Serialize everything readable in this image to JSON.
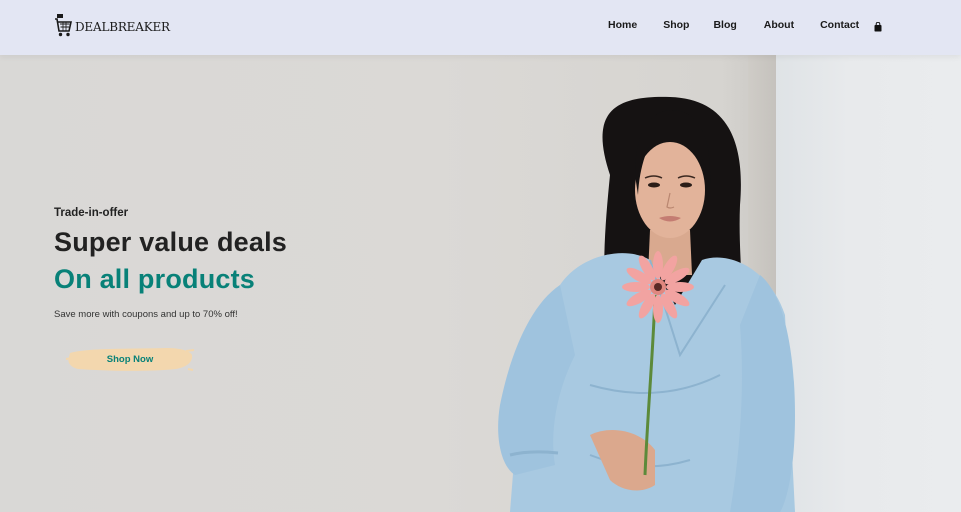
{
  "brand": {
    "name": "DEALBREAKER",
    "icon": "cart-logo-icon"
  },
  "nav": {
    "items": [
      {
        "label": "Home"
      },
      {
        "label": "Shop"
      },
      {
        "label": "Blog"
      },
      {
        "label": "About"
      },
      {
        "label": "Contact"
      }
    ],
    "cart_icon": "shopping-bag-icon"
  },
  "hero": {
    "eyebrow": "Trade-in-offer",
    "headline": "Super value deals",
    "headline_accent": "On all products",
    "subtext": "Save more with coupons and up to 70% off!",
    "cta_label": "Shop Now"
  },
  "colors": {
    "accent": "#088178",
    "header_bg": "#e3e6f3",
    "cta_bg": "#f3d7ae"
  }
}
